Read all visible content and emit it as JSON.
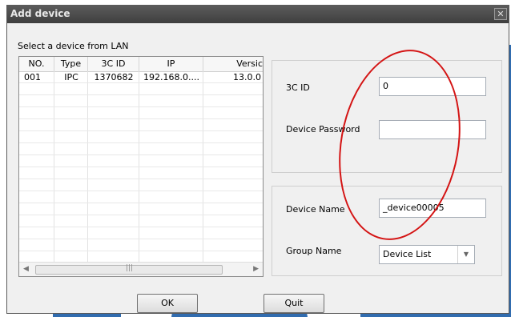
{
  "window": {
    "title": "Add device",
    "close_glyph": "✕"
  },
  "lan_label": "Select a device from LAN",
  "table": {
    "columns": [
      "NO.",
      "Type",
      "3C ID",
      "IP",
      "Versic"
    ],
    "rows": [
      [
        "001",
        "IPC",
        "1370682",
        "192.168.0....",
        "13.0.0"
      ]
    ],
    "scrollbar_grip": "|||"
  },
  "form": {
    "id_label": "3C ID",
    "id_value": "0",
    "password_label": "Device Password",
    "password_value": "",
    "name_label": "Device Name",
    "name_value": "_device00005",
    "group_label": "Group Name",
    "group_value": "Device List"
  },
  "buttons": {
    "ok": "OK",
    "quit": "Quit"
  },
  "colors": {
    "annotation_ring": "#d41414",
    "watermark": "#1f5fa8"
  }
}
